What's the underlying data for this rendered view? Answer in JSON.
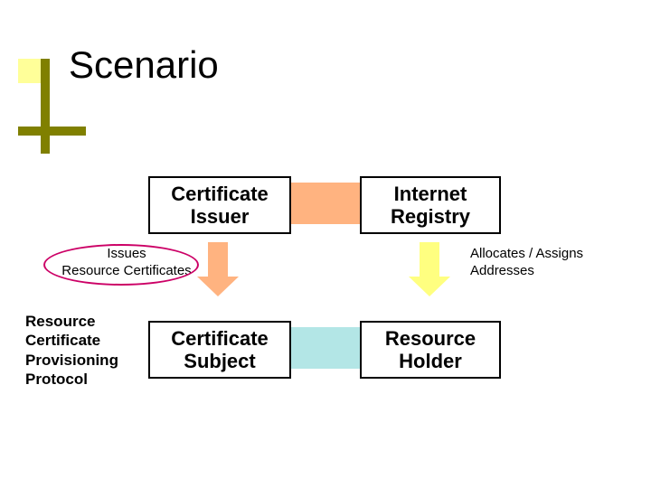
{
  "title": "Scenario",
  "boxes": {
    "cert_issuer": "Certificate\nIssuer",
    "internet_registry": "Internet\nRegistry",
    "cert_subject": "Certificate\nSubject",
    "resource_holder": "Resource\nHolder"
  },
  "labels": {
    "issues": "Issues\nResource Certificates",
    "allocates": "Allocates / Assigns\nAddresses",
    "protocol": "Resource\nCertificate\nProvisioning\nProtocol"
  }
}
